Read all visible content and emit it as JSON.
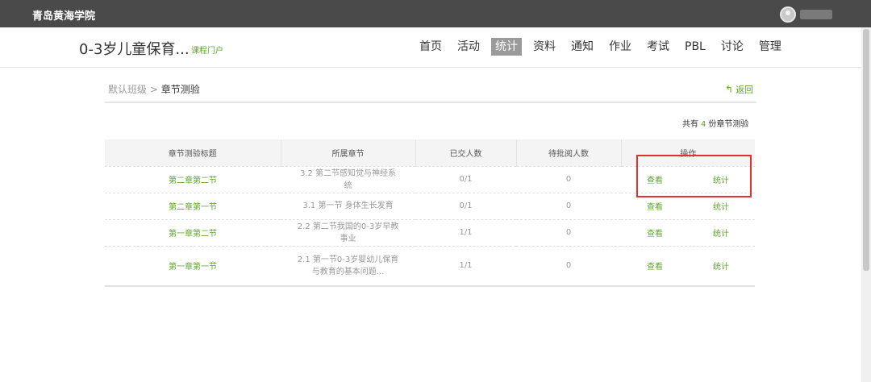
{
  "topbar": {
    "school": "青岛黄海学院"
  },
  "course": {
    "title": "0-3岁儿童保育...",
    "portal": "课程门户"
  },
  "nav": [
    {
      "label": "首页",
      "active": false
    },
    {
      "label": "活动",
      "active": false
    },
    {
      "label": "统计",
      "active": true
    },
    {
      "label": "资料",
      "active": false
    },
    {
      "label": "通知",
      "active": false
    },
    {
      "label": "作业",
      "active": false
    },
    {
      "label": "考试",
      "active": false
    },
    {
      "label": "PBL",
      "active": false
    },
    {
      "label": "讨论",
      "active": false
    },
    {
      "label": "管理",
      "active": false
    }
  ],
  "breadcrumb": {
    "parent": "默认班级",
    "sep": ">",
    "current": "章节测验"
  },
  "back_label": "返回",
  "summary": {
    "prefix": "共有",
    "count": "4",
    "suffix": "份章节测验"
  },
  "table": {
    "headers": [
      "章节测验标题",
      "所属章节",
      "已交人数",
      "待批阅人数",
      "操作"
    ],
    "rows": [
      {
        "title": "第二章第二节",
        "chapter": "3.2 第二节感知觉与神经系统",
        "submitted": "0/1",
        "pending": "0",
        "view": "查看",
        "stats": "统计"
      },
      {
        "title": "第二章第一节",
        "chapter": "3.1 第一节 身体生长发育",
        "submitted": "0/1",
        "pending": "0",
        "view": "查看",
        "stats": "统计"
      },
      {
        "title": "第一章第二节",
        "chapter": "2.2 第二节我国的0-3岁早教事业",
        "submitted": "1/1",
        "pending": "0",
        "view": "查看",
        "stats": "统计"
      },
      {
        "title": "第一章第一节",
        "chapter": "2.1 第一节0-3岁婴幼儿保育与教育的基本问题...",
        "submitted": "1/1",
        "pending": "0",
        "view": "查看",
        "stats": "统计"
      }
    ]
  },
  "colors": {
    "accent": "#5fa52d",
    "topbar": "#4a4a4a",
    "highlight": "#e03030"
  }
}
